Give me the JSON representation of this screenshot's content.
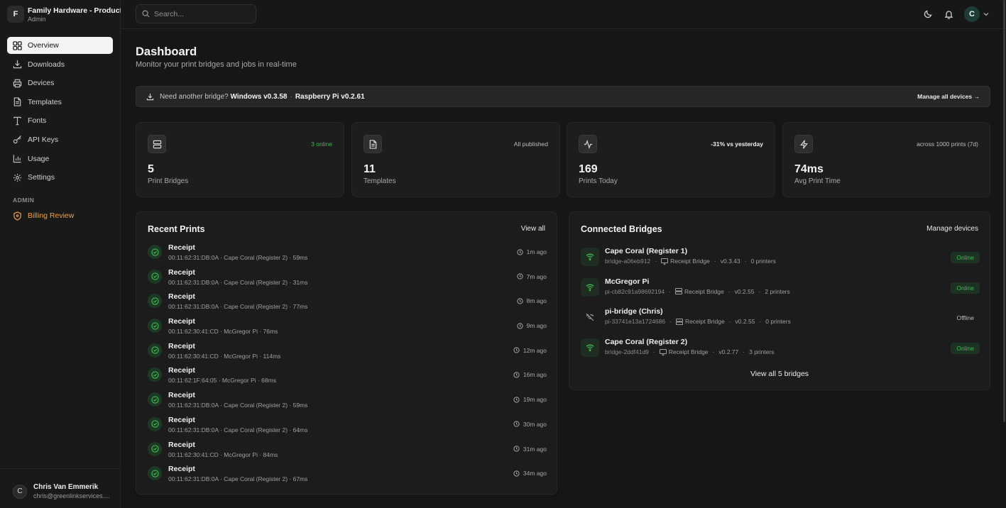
{
  "org": {
    "initial": "F",
    "name": "Family Hardware - Production",
    "role": "Admin"
  },
  "nav": {
    "items": [
      {
        "label": "Overview",
        "icon": "grid-icon",
        "active": true
      },
      {
        "label": "Downloads",
        "icon": "download-icon"
      },
      {
        "label": "Devices",
        "icon": "printer-icon"
      },
      {
        "label": "Templates",
        "icon": "file-icon"
      },
      {
        "label": "Fonts",
        "icon": "type-icon"
      },
      {
        "label": "API Keys",
        "icon": "key-icon"
      },
      {
        "label": "Usage",
        "icon": "bar-chart-icon"
      },
      {
        "label": "Settings",
        "icon": "gear-icon"
      }
    ],
    "admin_section": "ADMIN",
    "billing_label": "Billing Review"
  },
  "user": {
    "initial": "C",
    "name": "Chris Van Emmerik",
    "email": "chris@greenlinkservices...."
  },
  "topbar": {
    "search_placeholder": "Search...",
    "avatar_initial": "C"
  },
  "page": {
    "title": "Dashboard",
    "subtitle": "Monitor your print bridges and jobs in real-time"
  },
  "banner": {
    "prefix": "Need another bridge?",
    "windows": "Windows v0.3.58",
    "separator": "·",
    "pi": "Raspberry Pi v0.2.61",
    "link": "Manage all devices →"
  },
  "stats": [
    {
      "value": "5",
      "label": "Print Bridges",
      "badge": "3 online",
      "icon": "server-icon"
    },
    {
      "value": "11",
      "label": "Templates",
      "badge": "All published",
      "icon": "file-icon"
    },
    {
      "value": "169",
      "label": "Prints Today",
      "badge": "-31% vs yesterday",
      "icon": "activity-icon"
    },
    {
      "value": "74ms",
      "label": "Avg Print Time",
      "badge": "across 1000 prints (7d)",
      "icon": "zap-icon"
    }
  ],
  "recent_prints": {
    "title": "Recent Prints",
    "link": "View all",
    "rows": [
      {
        "title": "Receipt",
        "meta": "00:11:62:31:DB:0A · Cape Coral (Register 2) · 59ms",
        "time": "1m ago"
      },
      {
        "title": "Receipt",
        "meta": "00:11:62:31:DB:0A · Cape Coral (Register 2) · 31ms",
        "time": "7m ago"
      },
      {
        "title": "Receipt",
        "meta": "00:11:62:31:DB:0A · Cape Coral (Register 2) · 77ms",
        "time": "8m ago"
      },
      {
        "title": "Receipt",
        "meta": "00:11:62:30:41:CD · McGregor Pi · 76ms",
        "time": "9m ago"
      },
      {
        "title": "Receipt",
        "meta": "00:11:62:30:41:CD · McGregor Pi · 114ms",
        "time": "12m ago"
      },
      {
        "title": "Receipt",
        "meta": "00:11:62:1F:64:05 · McGregor Pi · 68ms",
        "time": "16m ago"
      },
      {
        "title": "Receipt",
        "meta": "00:11:62:31:DB:0A · Cape Coral (Register 2) · 59ms",
        "time": "19m ago"
      },
      {
        "title": "Receipt",
        "meta": "00:11:62:31:DB:0A · Cape Coral (Register 2) · 64ms",
        "time": "30m ago"
      },
      {
        "title": "Receipt",
        "meta": "00:11:62:30:41:CD · McGregor Pi · 84ms",
        "time": "31m ago"
      },
      {
        "title": "Receipt",
        "meta": "00:11:62:31:DB:0A · Cape Coral (Register 2) · 67ms",
        "time": "34m ago"
      }
    ]
  },
  "bridges": {
    "title": "Connected Bridges",
    "link": "Manage devices",
    "rows": [
      {
        "name": "Cape Coral (Register 1)",
        "id": "bridge-a06eb912",
        "type": "Receipt Bridge",
        "type_icon": "monitor-icon",
        "version": "v0.3.43",
        "printers": "0 printers",
        "status": "Online",
        "online": true
      },
      {
        "name": "McGregor Pi",
        "id": "pi-cb82c91a98692194",
        "type": "Receipt Bridge",
        "type_icon": "server-icon",
        "version": "v0.2.55",
        "printers": "2 printers",
        "status": "Online",
        "online": true
      },
      {
        "name": "pi-bridge (Chris)",
        "id": "pi-33741e13a1724686",
        "type": "Receipt Bridge",
        "type_icon": "server-icon",
        "version": "v0.2.55",
        "printers": "0 printers",
        "status": "Offline",
        "online": false
      },
      {
        "name": "Cape Coral (Register 2)",
        "id": "bridge-2ddf41d9",
        "type": "Receipt Bridge",
        "type_icon": "monitor-icon",
        "version": "v0.2.77",
        "printers": "3 printers",
        "status": "Online",
        "online": true
      }
    ],
    "view_all": "View all 5 bridges"
  }
}
